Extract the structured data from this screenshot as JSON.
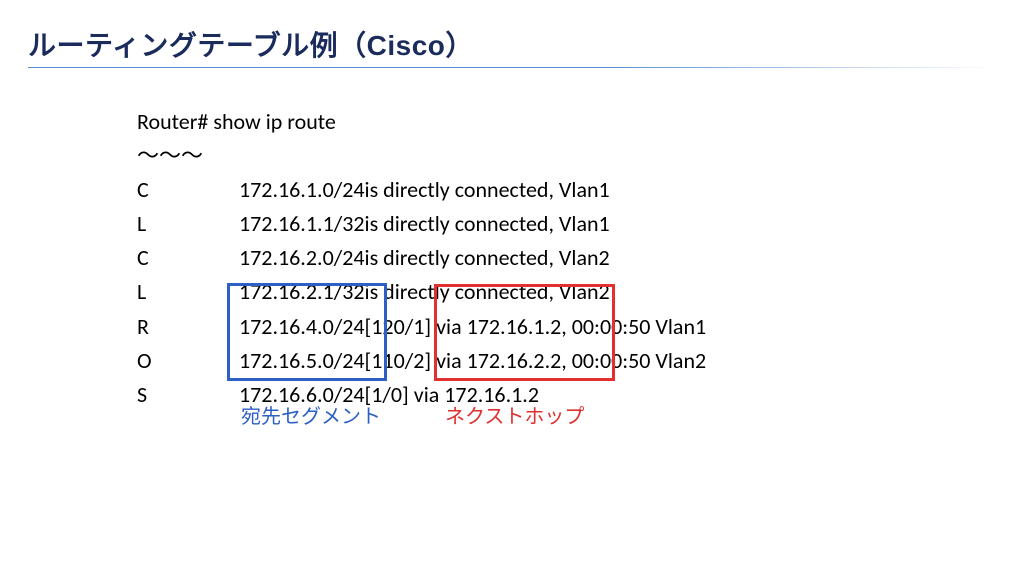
{
  "title": "ルーティングテーブル例（Cisco）",
  "prompt": "Router# show ip route",
  "omitted": "～～～",
  "routes": [
    {
      "code": "C",
      "dest": "172.16.1.0/24",
      "rest": " is directly connected, Vlan1"
    },
    {
      "code": "L",
      "dest": "172.16.1.1/32",
      "rest": " is directly connected, Vlan1"
    },
    {
      "code": "C",
      "dest": "172.16.2.0/24",
      "rest": " is directly connected, Vlan2"
    },
    {
      "code": "L",
      "dest": "172.16.2.1/32",
      "rest": " is directly connected, Vlan2"
    },
    {
      "code": "R",
      "dest": "172.16.4.0/24",
      "rest": " [120/1] via 172.16.1.2, 00:00:50 Vlan1"
    },
    {
      "code": "O",
      "dest": "172.16.5.0/24",
      "rest": " [110/2] via 172.16.2.2, 00:00:50 Vlan2"
    },
    {
      "code": "S",
      "dest": "172.16.6.0/24",
      "rest": " [1/0] via 172.16.1.2"
    }
  ],
  "annotations": {
    "destination_segment": "宛先セグメント",
    "next_hop": "ネクストホップ"
  },
  "colors": {
    "title": "#1a2b5c",
    "divider": "#5a8dd6",
    "blue_box": "#2d5fc4",
    "red_box": "#e03030"
  }
}
